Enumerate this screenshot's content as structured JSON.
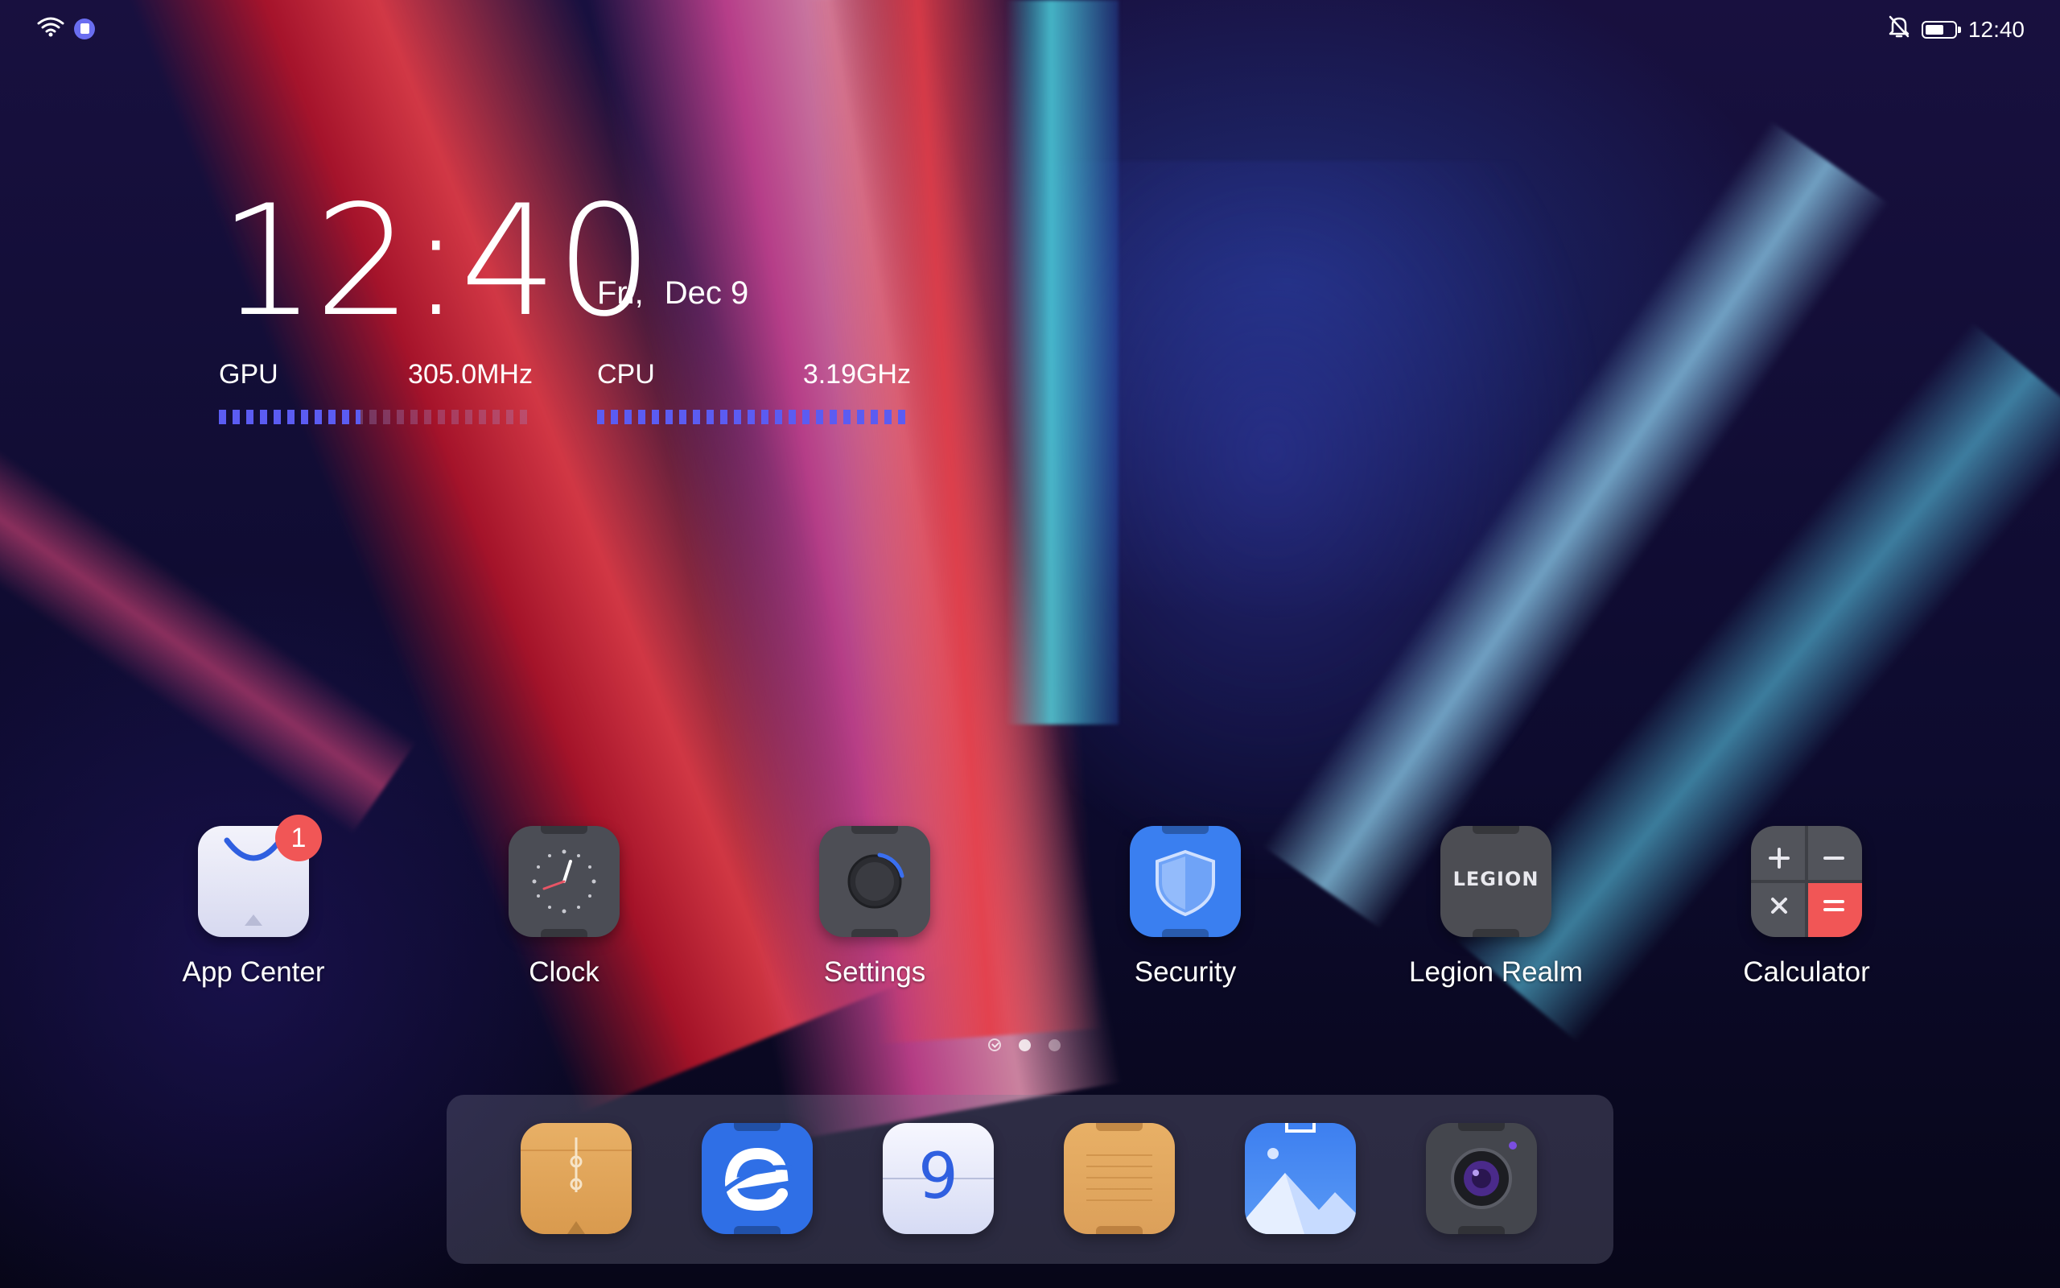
{
  "status_bar": {
    "time": "12:40",
    "icons_left": [
      "wifi-icon",
      "sd-card-icon"
    ],
    "icons_right": [
      "alarm-off-icon",
      "battery-icon"
    ],
    "battery_level": 0.7
  },
  "widget": {
    "time": "12:40",
    "day": "Fri,",
    "date": "Dec 9",
    "gpu": {
      "label": "GPU",
      "value": "305.0MHz",
      "level": 0.45
    },
    "cpu": {
      "label": "CPU",
      "value": "3.19GHz",
      "level": 1.0
    }
  },
  "apps": [
    {
      "label": "App Center",
      "icon": "shopping-bag-icon",
      "badge": "1"
    },
    {
      "label": "Clock",
      "icon": "clock-icon"
    },
    {
      "label": "Settings",
      "icon": "gear-knob-icon"
    },
    {
      "label": "Security",
      "icon": "shield-icon"
    },
    {
      "label": "Legion Realm",
      "icon": "legion-logo-icon",
      "icon_text": "LEGION"
    },
    {
      "label": "Calculator",
      "icon": "calculator-icon"
    }
  ],
  "pager": {
    "pages": 3,
    "current": 1
  },
  "dock": [
    {
      "icon": "file-manager-icon"
    },
    {
      "icon": "browser-icon"
    },
    {
      "icon": "calendar-icon",
      "icon_text": "9"
    },
    {
      "icon": "notes-icon"
    },
    {
      "icon": "gallery-icon"
    },
    {
      "icon": "camera-icon"
    }
  ],
  "colors": {
    "accent": "#5b5cf2",
    "badge": "#f15656",
    "security": "#3a7ff0"
  }
}
